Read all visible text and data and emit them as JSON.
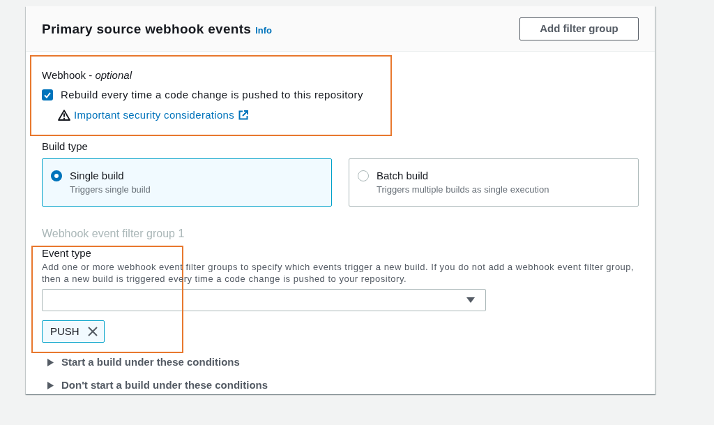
{
  "panel": {
    "title": "Primary source webhook events",
    "info_link": "Info",
    "button": "Add filter group"
  },
  "webhook": {
    "label": "Webhook - *optional*",
    "highlighted": true,
    "checkbox": {
      "label": "Rebuild every time a code change is pushed to this repository",
      "checked": true
    },
    "warning_link": "Important security considerations"
  },
  "build_type": {
    "label": "Build type",
    "options": [
      {
        "title": "Single build",
        "description": "Triggers single build",
        "selected": true
      },
      {
        "title": "Batch build",
        "description": "Triggers multiple builds as single execution",
        "selected": false
      }
    ]
  },
  "filter_group": {
    "title": "Webhook event filter group 1",
    "event_type": {
      "label": "Event type",
      "highlighted": true,
      "description": "Add one or more webhook event filter groups to specify which events trigger a new build. If you do not add a webhook event filter group, then a new build is triggered every time a code change is pushed to your repository.",
      "tokens": [
        "PUSH"
      ]
    },
    "sections": [
      {
        "label": "Start a build under these conditions",
        "expanded": false
      },
      {
        "label": "Don't start a build under these conditions",
        "expanded": false
      }
    ]
  }
}
